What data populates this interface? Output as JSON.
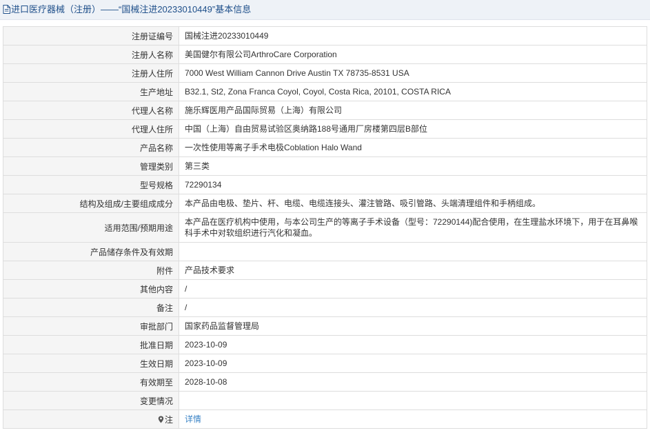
{
  "header": {
    "title": "进口医疗器械（注册）——“国械注进20233010449”基本信息"
  },
  "rows": [
    {
      "label": "注册证编号",
      "value": "国械注进20233010449"
    },
    {
      "label": "注册人名称",
      "value": "美国健尔有限公司ArthroCare Corporation"
    },
    {
      "label": "注册人住所",
      "value": "7000 West William Cannon Drive Austin TX 78735-8531 USA"
    },
    {
      "label": "生产地址",
      "value": "B32.1, St2, Zona Franca Coyol, Coyol, Costa Rica, 20101, COSTA RICA"
    },
    {
      "label": "代理人名称",
      "value": "施乐辉医用产品国际贸易（上海）有限公司"
    },
    {
      "label": "代理人住所",
      "value": "中国（上海）自由贸易试验区奥纳路188号通用厂房楼第四层B部位"
    },
    {
      "label": "产品名称",
      "value": "一次性使用等离子手术电极Coblation Halo Wand"
    },
    {
      "label": "管理类别",
      "value": "第三类"
    },
    {
      "label": "型号规格",
      "value": "72290134"
    },
    {
      "label": "结构及组成/主要组成成分",
      "value": "本产品由电极、垫片、杆、电缆、电缆连接头、灌注管路、吸引管路、头端清理组件和手柄组成。"
    },
    {
      "label": "适用范围/预期用途",
      "value": "本产品在医疗机构中使用，与本公司生产的等离子手术设备（型号：72290144)配合使用，在生理盐水环境下，用于在耳鼻喉科手术中对软组织进行汽化和凝血。"
    },
    {
      "label": "产品储存条件及有效期",
      "value": ""
    },
    {
      "label": "附件",
      "value": "产品技术要求"
    },
    {
      "label": "其他内容",
      "value": "/"
    },
    {
      "label": "备注",
      "value": "/"
    },
    {
      "label": "审批部门",
      "value": "国家药品监督管理局"
    },
    {
      "label": "批准日期",
      "value": "2023-10-09"
    },
    {
      "label": "生效日期",
      "value": "2023-10-09"
    },
    {
      "label": "有效期至",
      "value": "2028-10-08"
    },
    {
      "label": "变更情况",
      "value": ""
    }
  ],
  "note": {
    "label": "注",
    "link_text": "详情",
    "icon": "map-pin-icon"
  },
  "colors": {
    "title_text": "#1e4f8a",
    "label_bg": "#f5f5f5",
    "border": "#dddddd",
    "link": "#3a83c6"
  }
}
